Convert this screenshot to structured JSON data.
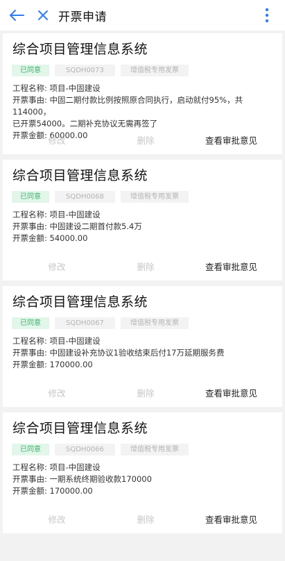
{
  "header": {
    "title": "开票申请"
  },
  "colors": {
    "accent": "#2f7cf6",
    "status_green_text": "#3fb36d",
    "status_green_bg": "#e2f6ea",
    "muted": "#c7c7c7"
  },
  "labels": {
    "project": "工程名称:",
    "reason": "开票事由:",
    "amount": "开票金额:"
  },
  "actions": {
    "edit": "修改",
    "delete": "删除",
    "view": "查看审批意见"
  },
  "cards": [
    {
      "title": "综合项目管理信息系统",
      "status": "已同意",
      "code": "SQDH0073",
      "invoice_type": "增值税专用发票",
      "project": "项目-中固建设",
      "reason_line1": "中固二期付款比例按照原合同执行，启动就付95%，共114000，",
      "reason_line2": "已开票54000。二期补充协议无需再签了",
      "amount": "60000.00"
    },
    {
      "title": "综合项目管理信息系统",
      "status": "已同意",
      "code": "SQDH0068",
      "invoice_type": "增值税专用发票",
      "project": "项目-中固建设",
      "reason_line1": "中固建设二期首付款5.4万",
      "reason_line2": "",
      "amount": "54000.00"
    },
    {
      "title": "综合项目管理信息系统",
      "status": "已同意",
      "code": "SQDH0067",
      "invoice_type": "增值税专用发票",
      "project": "项目-中固建设",
      "reason_line1": "中固建设补充协议1验收结束后付17万延期服务费",
      "reason_line2": "",
      "amount": "170000.00"
    },
    {
      "title": "综合项目管理信息系统",
      "status": "已同意",
      "code": "SQDH0066",
      "invoice_type": "增值税专用发票",
      "project": "项目-中固建设",
      "reason_line1": "一期系统终期验收款170000",
      "reason_line2": "",
      "amount": "170000.00"
    }
  ]
}
